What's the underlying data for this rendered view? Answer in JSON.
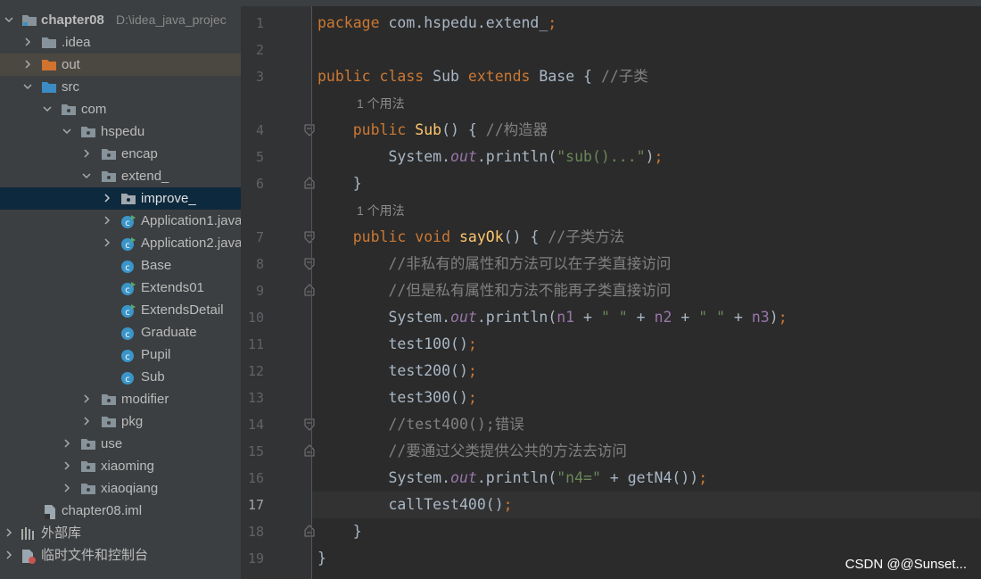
{
  "tree": {
    "items": [
      {
        "label": "chapter08",
        "path": "D:\\idea_java_projec",
        "expanded": true,
        "icon": "module-folder-icon"
      },
      {
        "label": ".idea",
        "expanded": false,
        "icon": "folder-icon"
      },
      {
        "label": "out",
        "expanded": false,
        "icon": "excluded-folder-icon"
      },
      {
        "label": "src",
        "expanded": true,
        "icon": "source-folder-icon"
      },
      {
        "label": "com",
        "expanded": true,
        "icon": "package-icon"
      },
      {
        "label": "hspedu",
        "expanded": true,
        "icon": "package-icon"
      },
      {
        "label": "encap",
        "expanded": false,
        "icon": "package-icon"
      },
      {
        "label": "extend_",
        "expanded": true,
        "icon": "package-icon"
      },
      {
        "label": "improve_",
        "expanded": false,
        "icon": "package-icon"
      },
      {
        "label": "Application1.java",
        "icon": "java-class-icon"
      },
      {
        "label": "Application2.java",
        "icon": "java-class-icon"
      },
      {
        "label": "Base",
        "icon": "java-class-icon"
      },
      {
        "label": "Extends01",
        "icon": "java-class-icon"
      },
      {
        "label": "ExtendsDetail",
        "icon": "java-class-icon"
      },
      {
        "label": "Graduate",
        "icon": "java-class-icon"
      },
      {
        "label": "Pupil",
        "icon": "java-class-icon"
      },
      {
        "label": "Sub",
        "icon": "java-class-icon"
      },
      {
        "label": "modifier",
        "expanded": false,
        "icon": "package-icon"
      },
      {
        "label": "pkg",
        "expanded": false,
        "icon": "package-icon"
      },
      {
        "label": "use",
        "expanded": false,
        "icon": "package-icon"
      },
      {
        "label": "xiaoming",
        "expanded": false,
        "icon": "package-icon"
      },
      {
        "label": "xiaoqiang",
        "expanded": false,
        "icon": "package-icon"
      },
      {
        "label": "chapter08.iml",
        "icon": "iml-file-icon"
      },
      {
        "label": "外部库",
        "expanded": false,
        "icon": "library-icon"
      },
      {
        "label": "临时文件和控制台",
        "expanded": false,
        "icon": "scratch-icon"
      }
    ]
  },
  "editor": {
    "current_line": "17",
    "line_numbers": [
      "1",
      "2",
      "3",
      "4",
      "5",
      "6",
      "7",
      "8",
      "9",
      "10",
      "11",
      "12",
      "13",
      "14",
      "15",
      "16",
      "17",
      "18",
      "19"
    ],
    "usage_hints": [
      "1 个用法",
      "1 个用法"
    ],
    "code": {
      "l1_kw": "package",
      "l1_rest": "com.hspedu.extend_",
      "l1_semi": ";",
      "l3_kw": "public class",
      "l3_name": "Sub",
      "l3_ext": "extends",
      "l3_base": "Base {",
      "l3_cmt": "//子类",
      "l4_kw": "public",
      "l4_fn": "Sub",
      "l4_rest": "() {",
      "l4_cmt": "//构造器",
      "l5_obj": "System.",
      "l5_out": "out",
      "l5_call": ".println(",
      "l5_str": "\"sub()...\"",
      "l5_end": ")",
      "l5_semi": ";",
      "l6": "}",
      "l7_kw": "public void",
      "l7_fn": "sayOk",
      "l7_rest": "() {",
      "l7_cmt": "//子类方法",
      "l8_cmt": "//非私有的属性和方法可以在子类直接访问",
      "l9_cmt": "//但是私有属性和方法不能再子类直接访问",
      "l10_obj": "System.",
      "l10_out": "out",
      "l10_call": ".println(",
      "l10_n1": "n1",
      "l10_p1": " + ",
      "l10_s1": "\" \"",
      "l10_p2": " + ",
      "l10_n2": "n2",
      "l10_p3": " + ",
      "l10_s2": "\" \"",
      "l10_p4": " + ",
      "l10_n3": "n3",
      "l10_end": ")",
      "l10_semi": ";",
      "l11": "test100()",
      "l12": "test200()",
      "l13": "test300()",
      "semi": ";",
      "l14_cmt": "//test400();错误",
      "l15_cmt": "//要通过父类提供公共的方法去访问",
      "l16_obj": "System.",
      "l16_out": "out",
      "l16_call": ".println(",
      "l16_str": "\"n4=\"",
      "l16_rest": " + getN4())",
      "l16_semi": ";",
      "l17": "callTest400()",
      "l17_semi": ";",
      "l18": "}",
      "l19": "}"
    }
  },
  "watermark": "CSDN @@Sunset..."
}
